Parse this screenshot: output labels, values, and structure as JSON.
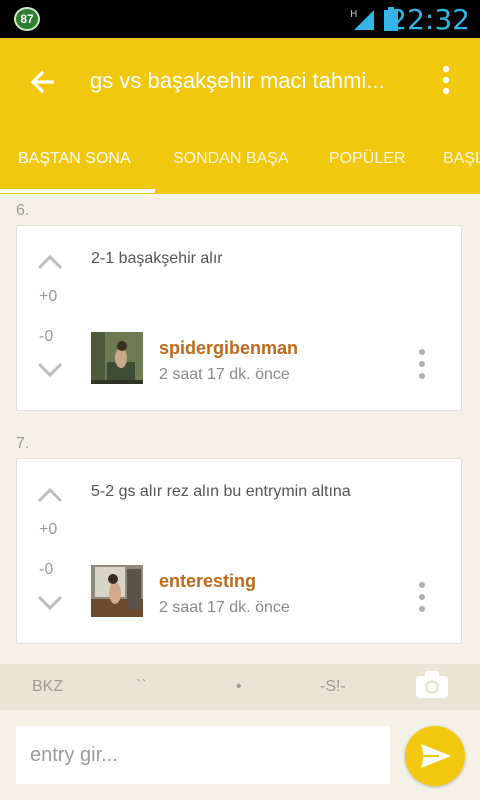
{
  "status_bar": {
    "notification_count": "87",
    "time": "22:32",
    "network_label": "H"
  },
  "app_bar": {
    "title": "gs vs başakşehir maci tahmi..."
  },
  "tabs": [
    {
      "label": "BAŞTAN SONA",
      "active": true
    },
    {
      "label": "SONDAN BAŞA",
      "active": false
    },
    {
      "label": "POPÜLER",
      "active": false
    },
    {
      "label": "BAŞL",
      "active": false
    }
  ],
  "entries": [
    {
      "number": "6.",
      "text": "2-1 başakşehir alır",
      "upvotes": "+0",
      "downvotes": "-0",
      "author": "spidergibenman",
      "time": "2 saat 17 dk. önce"
    },
    {
      "number": "7.",
      "text": "5-2 gs alır rez alın bu entrymin altına",
      "upvotes": "+0",
      "downvotes": "-0",
      "author": "enteresting",
      "time": "2 saat 17 dk. önce"
    }
  ],
  "toolbar": {
    "bkz": "BKZ",
    "backtick": "``",
    "bullet": "•",
    "spoiler": "-S!-"
  },
  "input": {
    "placeholder": "entry gir..."
  },
  "colors": {
    "accent": "#f2c80f",
    "author": "#c0691a",
    "background": "#f5f1e6",
    "clock": "#33b5e5"
  }
}
